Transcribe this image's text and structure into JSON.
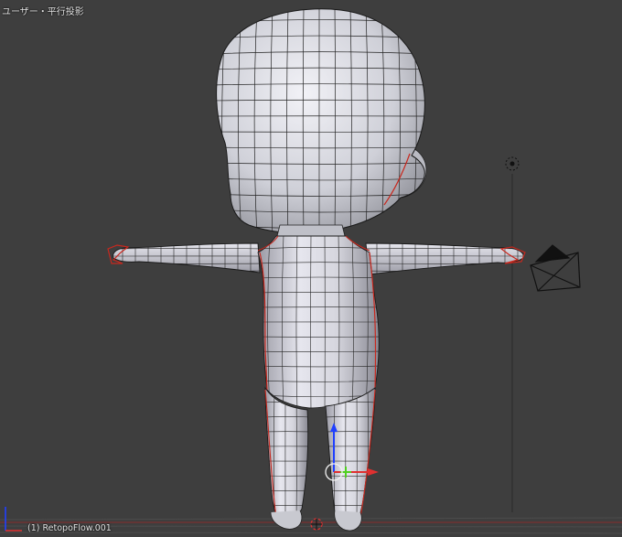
{
  "viewport": {
    "view_label": "ユーザー・平行投影",
    "object_label": "(1) RetopoFlow.001"
  },
  "colors": {
    "background": "#3e3e3e",
    "grid_line": "#4a4a4a",
    "mesh_fill": "#cfcfd6",
    "wire": "#2a2a2a",
    "seam": "#c8281e",
    "axis_x": "#e03030",
    "axis_y": "#50d020",
    "axis_z": "#2040ff"
  },
  "icons": {
    "lamp": "lamp-icon",
    "camera": "camera-icon",
    "manipulator": "transform-manipulator-icon",
    "cursor": "3d-cursor-icon"
  }
}
